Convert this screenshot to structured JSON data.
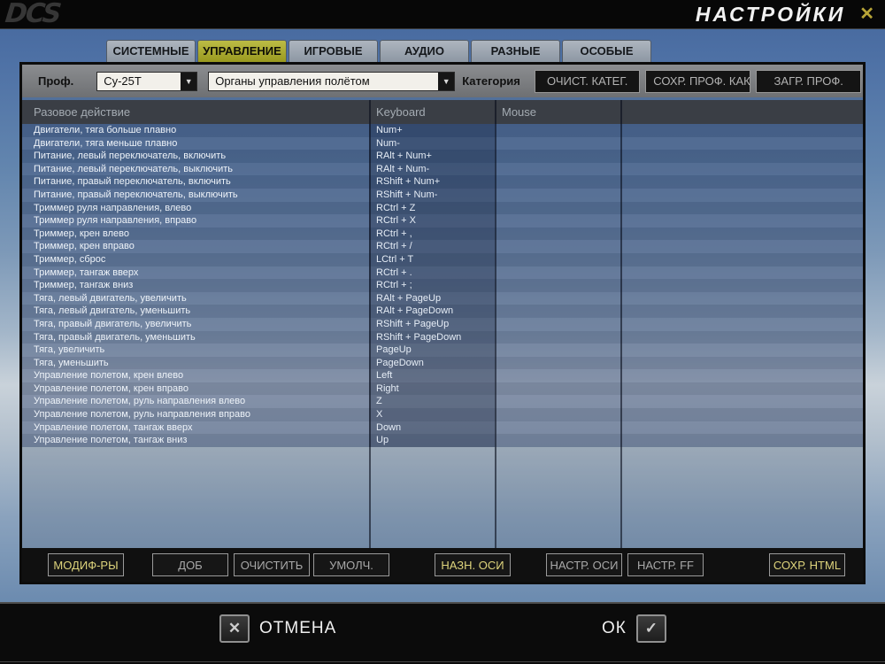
{
  "titlebar": {
    "logo": "DCS",
    "title": "НАСТРОЙКИ",
    "close_glyph": "✕"
  },
  "tabs": [
    {
      "label": "СИСТЕМНЫЕ",
      "active": false
    },
    {
      "label": "УПРАВЛЕНИЕ",
      "active": true
    },
    {
      "label": "ИГРОВЫЕ",
      "active": false
    },
    {
      "label": "АУДИО",
      "active": false
    },
    {
      "label": "РАЗНЫЕ",
      "active": false
    },
    {
      "label": "ОСОБЫЕ",
      "active": false
    }
  ],
  "profile_bar": {
    "prof_label": "Проф.",
    "profile_value": "Су-25Т",
    "category_value": "Органы управления полётом",
    "category_label": "Категория",
    "dropdown_arrow": "▼",
    "buttons": [
      {
        "label": "ОЧИСТ. КАТЕГ."
      },
      {
        "label": "СОХР. ПРОФ. КАК"
      },
      {
        "label": "ЗАГР. ПРОФ."
      }
    ]
  },
  "table": {
    "headers": [
      "Разовое действие",
      "Keyboard",
      "Mouse",
      ""
    ],
    "rows": [
      {
        "action": "Двигатели, тяга больше плавно",
        "keyboard": "Num+",
        "mouse": ""
      },
      {
        "action": "Двигатели, тяга меньше плавно",
        "keyboard": "Num-",
        "mouse": ""
      },
      {
        "action": "Питание, левый переключатель, включить",
        "keyboard": "RAlt + Num+",
        "mouse": ""
      },
      {
        "action": "Питание, левый переключатель, выключить",
        "keyboard": "RAlt + Num-",
        "mouse": ""
      },
      {
        "action": "Питание, правый переключатель, включить",
        "keyboard": "RShift + Num+",
        "mouse": ""
      },
      {
        "action": "Питание, правый переключатель, выключить",
        "keyboard": "RShift + Num-",
        "mouse": ""
      },
      {
        "action": "Триммер руля направления, влево",
        "keyboard": "RCtrl + Z",
        "mouse": ""
      },
      {
        "action": "Триммер руля направления, вправо",
        "keyboard": "RCtrl + X",
        "mouse": ""
      },
      {
        "action": "Триммер, крен влево",
        "keyboard": "RCtrl + ,",
        "mouse": ""
      },
      {
        "action": "Триммер, крен вправо",
        "keyboard": "RCtrl + /",
        "mouse": ""
      },
      {
        "action": "Триммер, сброс",
        "keyboard": "LCtrl + T",
        "mouse": ""
      },
      {
        "action": "Триммер, тангаж вверх",
        "keyboard": "RCtrl + .",
        "mouse": ""
      },
      {
        "action": "Триммер, тангаж вниз",
        "keyboard": "RCtrl + ;",
        "mouse": ""
      },
      {
        "action": "Тяга, левый двигатель, увеличить",
        "keyboard": "RAlt + PageUp",
        "mouse": ""
      },
      {
        "action": "Тяга, левый двигатель, уменьшить",
        "keyboard": "RAlt + PageDown",
        "mouse": ""
      },
      {
        "action": "Тяга, правый двигатель, увеличить",
        "keyboard": "RShift + PageUp",
        "mouse": ""
      },
      {
        "action": "Тяга, правый двигатель, уменьшить",
        "keyboard": "RShift + PageDown",
        "mouse": ""
      },
      {
        "action": "Тяга, увеличить",
        "keyboard": "PageUp",
        "mouse": ""
      },
      {
        "action": "Тяга, уменьшить",
        "keyboard": "PageDown",
        "mouse": ""
      },
      {
        "action": "Управление полетом, крен влево",
        "keyboard": "Left",
        "mouse": ""
      },
      {
        "action": "Управление полетом, крен вправо",
        "keyboard": "Right",
        "mouse": ""
      },
      {
        "action": "Управление полетом, руль направления влево",
        "keyboard": "Z",
        "mouse": ""
      },
      {
        "action": "Управление полетом, руль направления вправо",
        "keyboard": "X",
        "mouse": ""
      },
      {
        "action": "Управление полетом, тангаж вверх",
        "keyboard": "Down",
        "mouse": ""
      },
      {
        "action": "Управление полетом, тангаж вниз",
        "keyboard": "Up",
        "mouse": ""
      }
    ]
  },
  "panel_buttons": [
    {
      "label": "МОДИФ-РЫ",
      "enabled": true
    },
    {
      "label": "ДОБ",
      "enabled": false
    },
    {
      "label": "ОЧИСТИТЬ",
      "enabled": false
    },
    {
      "label": "УМОЛЧ.",
      "enabled": false
    },
    {
      "label": "НАЗН. ОСИ",
      "enabled": true
    },
    {
      "label": "НАСТР. ОСИ",
      "enabled": false
    },
    {
      "label": "НАСТР. FF",
      "enabled": false
    },
    {
      "label": "СОХР. HTML",
      "enabled": true
    }
  ],
  "footer": {
    "cancel_label": "ОТМЕНА",
    "cancel_glyph": "✕",
    "ok_label": "ОК",
    "ok_glyph": "✓"
  }
}
